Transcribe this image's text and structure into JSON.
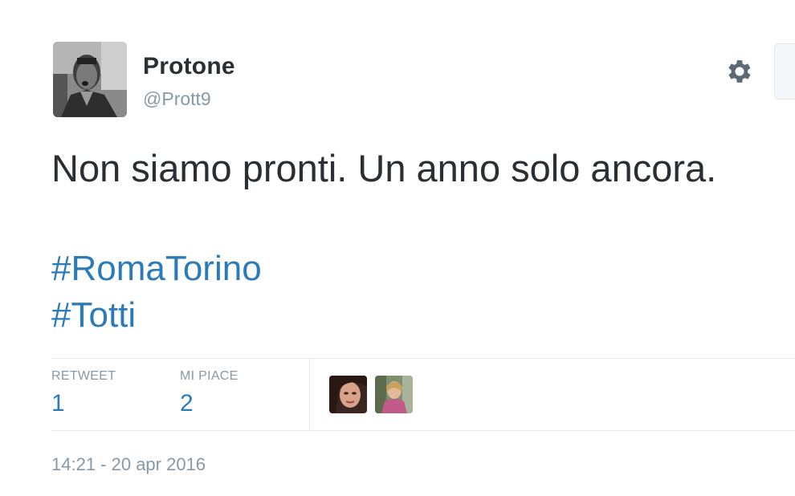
{
  "author": {
    "display_name": "Protone",
    "screen_name": "@Prott9",
    "avatar_icon": "profile-photo"
  },
  "actions": {
    "gear_icon": "gear-icon"
  },
  "tweet": {
    "text": "Non siamo pronti. Un anno solo ancora.",
    "hashtags": [
      "#RomaTorino",
      "#Totti"
    ]
  },
  "stats": {
    "retweet_label": "RETWEET",
    "retweet_count": "1",
    "likes_label": "MI PIACE",
    "likes_count": "2"
  },
  "likers": [
    {
      "icon": "liker-avatar-1"
    },
    {
      "icon": "liker-avatar-2"
    }
  ],
  "timestamp": "14:21 - 20 apr 2016",
  "colors": {
    "link": "#2b7bb9",
    "muted": "#8899a6",
    "text": "#292f33",
    "divider": "#e1e8ed"
  }
}
